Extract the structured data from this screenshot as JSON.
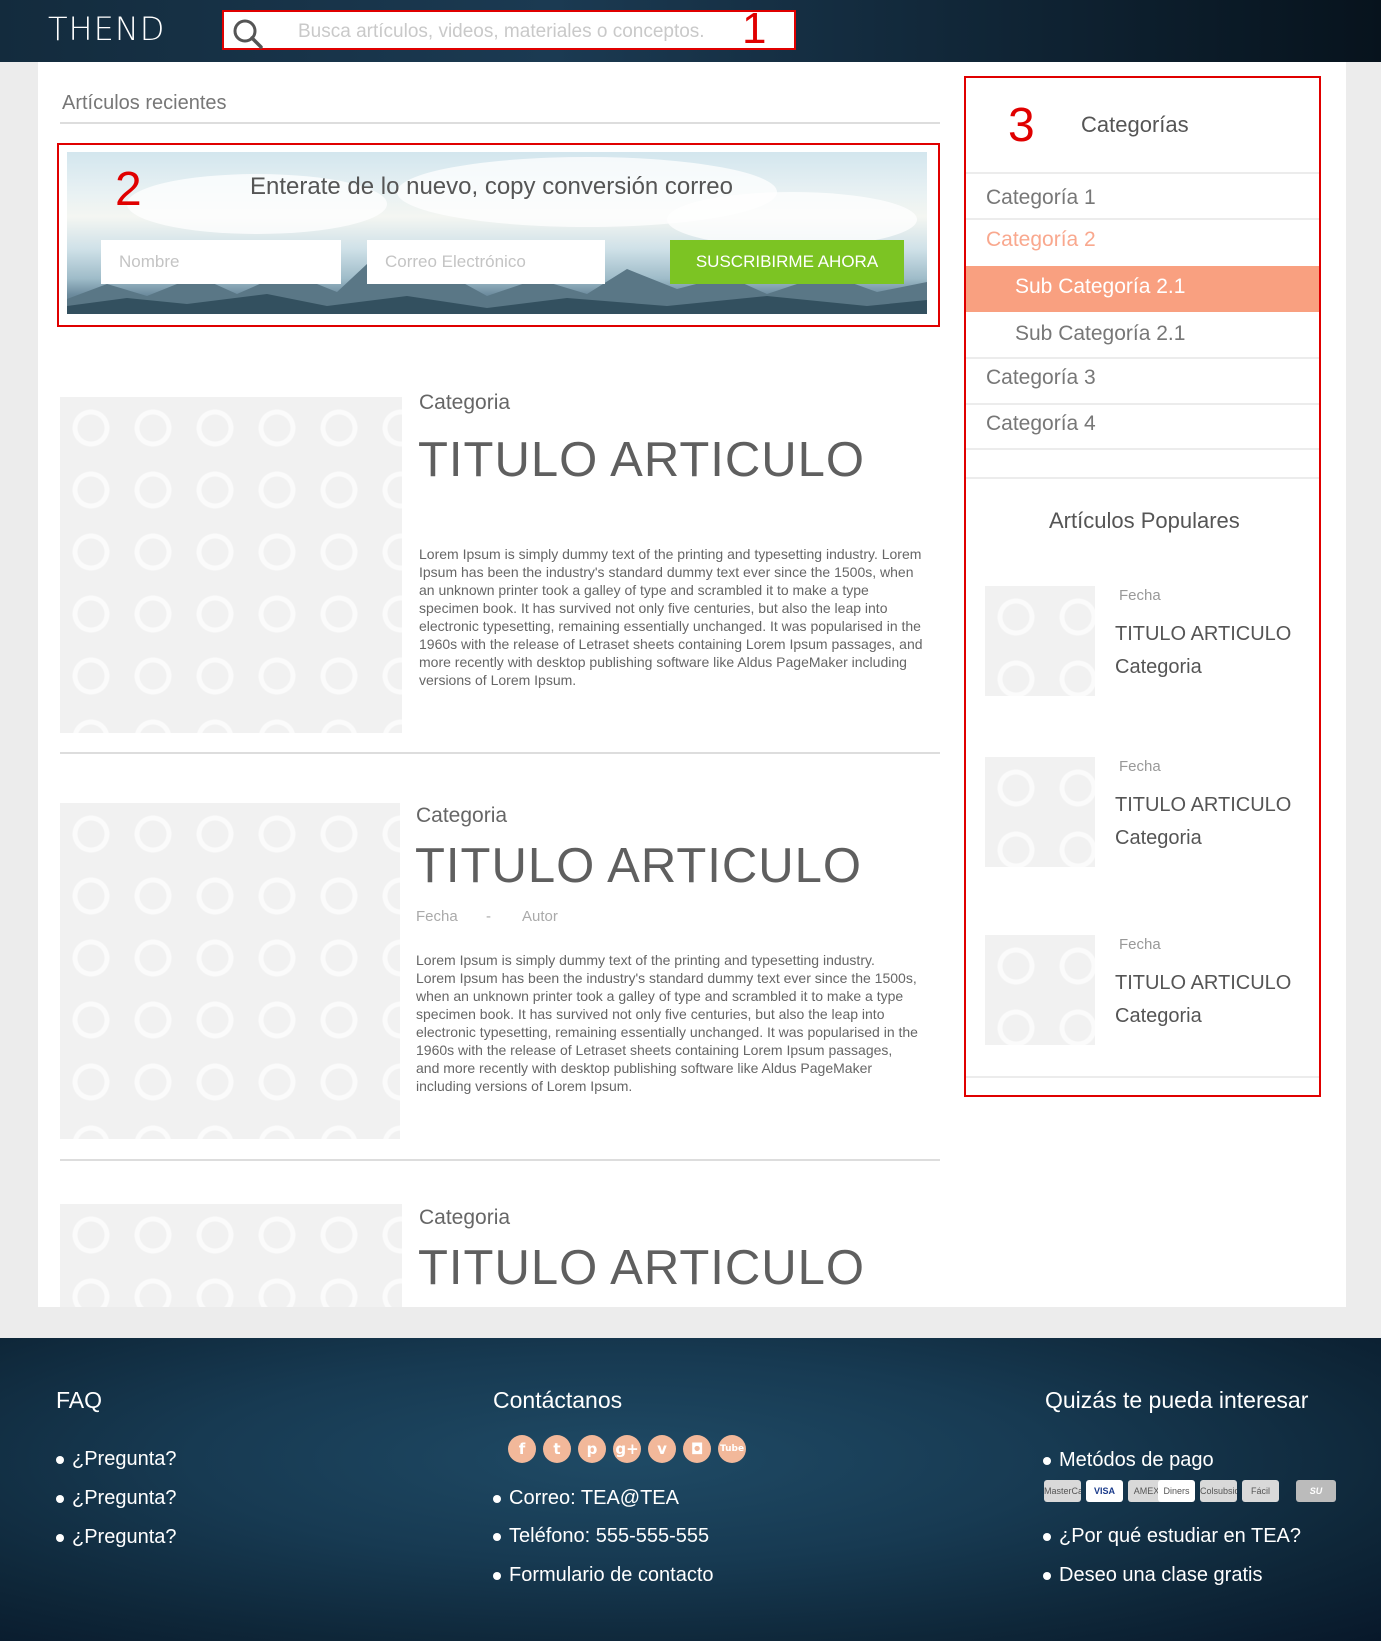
{
  "header": {
    "logo": "THEND",
    "search_placeholder": "Busca artículos, videos, materiales o conceptos."
  },
  "annotations": [
    "1",
    "2",
    "3"
  ],
  "recent": {
    "title": "Artículos recientes"
  },
  "newsletter": {
    "title": "Enterate de lo nuevo, copy conversión correo",
    "name_placeholder": "Nombre",
    "email_placeholder": "Correo Electrónico",
    "button": "SUSCRIBIRME AHORA"
  },
  "articles": [
    {
      "category": "Categoria",
      "title": "TITULO ARTICULO",
      "body": "Lorem Ipsum is simply dummy text of the printing and typesetting industry. Lorem Ipsum has been the industry's standard dummy text ever since the 1500s, when an unknown printer took a galley of type and scrambled it to make a type specimen book. It has survived not only five centuries, but also the leap into electronic typesetting, remaining essentially unchanged. It was popularised in the 1960s with the release of Letraset sheets containing Lorem Ipsum passages, and more recently with desktop publishing software like Aldus PageMaker including versions of Lorem Ipsum."
    },
    {
      "category": "Categoria",
      "title": "TITULO ARTICULO",
      "date": "Fecha",
      "separator": "-",
      "author": "Autor",
      "body": "Lorem Ipsum is simply dummy text of the printing and typesetting industry. Lorem Ipsum has been the industry's standard dummy text ever since the 1500s, when an unknown printer took a galley of type and scrambled it to make a type specimen book. It has survived not only five centuries, but also the leap into electronic typesetting, remaining essentially unchanged. It was popularised in the 1960s with the release of Letraset sheets containing Lorem Ipsum passages, and more recently with desktop publishing software like Aldus PageMaker including versions of Lorem Ipsum."
    },
    {
      "category": "Categoria",
      "title": "TITULO ARTICULO"
    }
  ],
  "sidebar": {
    "title": "Categorías",
    "categories": [
      "Categoría 1",
      "Categoría 2",
      "Categoría 3",
      "Categoría 4"
    ],
    "subcategories": [
      "Sub Categoría 2.1",
      "Sub Categoría 2.1"
    ],
    "active_color": "#f9a88e",
    "highlight_color": "#f9a080",
    "popular_title": "Artículos Populares",
    "popular": [
      {
        "date": "Fecha",
        "title": "TITULO ARTICULO",
        "category": "Categoria"
      },
      {
        "date": "Fecha",
        "title": "TITULO ARTICULO",
        "category": "Categoria"
      },
      {
        "date": "Fecha",
        "title": "TITULO ARTICULO",
        "category": "Categoria"
      }
    ]
  },
  "footer": {
    "faq_title": "FAQ",
    "faq_items": [
      "¿Pregunta?",
      "¿Pregunta?",
      "¿Pregunta?"
    ],
    "contact_title": "Contáctanos",
    "social_icons": [
      "facebook-icon",
      "twitter-icon",
      "pinterest-icon",
      "google-plus-icon",
      "vimeo-icon",
      "instagram-icon",
      "youtube-icon"
    ],
    "contact_items": [
      "Correo: TEA@TEA",
      "Teléfono: 555-555-555",
      "Formulario de contacto"
    ],
    "interest_title": "Quizás te pueda interesar",
    "interest_items": [
      "Metódos de pago",
      "¿Por qué estudiar en TEA?",
      "Deseo una clase gratis"
    ],
    "payment_cards": [
      "MasterCard",
      "VISA",
      "AMEX",
      "Diners Club",
      "Colsubsidio",
      "Fácil",
      "SU"
    ]
  }
}
